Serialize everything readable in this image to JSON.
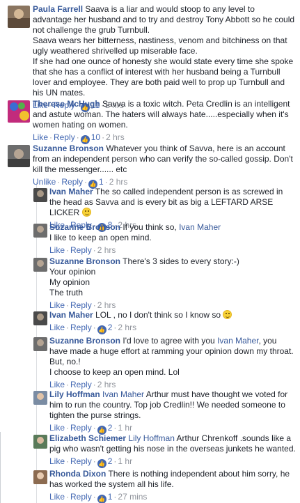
{
  "comments": [
    {
      "author": "Paula Farrell",
      "lines": [
        "Saava is a liar and would stoop to any level to advantage her husband and to try and destroy Tony Abbott so he could not challenge the grub Turnbull.",
        "Saava wears her bitterness, nastiness, venom and bitchiness on that ugly weathered shrivelled up miserable face.",
        "If she had one ounce of honesty she would state every time she spoke that she has a conflict of interest with her husband being a Turnbull lover and employee. They are both paid well to prop up Turnbull and his UN mates."
      ],
      "like": "Like",
      "reply": "Reply",
      "likes": "11",
      "time": "2 hrs"
    },
    {
      "author": "Therese McHugh",
      "lines": [
        "Savva is a toxic witch. Peta Credlin is an intelligent and astute woman. The haters will always hate.....especially when it's women hating on women."
      ],
      "like": "Like",
      "reply": "Reply",
      "likes": "10",
      "time": "2 hrs"
    },
    {
      "author": "Suzanne Bronson",
      "lines": [
        "Whatever you think of Savva, here is an account from an independent person who can verify the so-called gossip. Don't kill the messenger...... etc"
      ],
      "like": "Unlike",
      "reply": "Reply",
      "likes": "1",
      "time": "2 hrs"
    }
  ],
  "replies": [
    {
      "author": "Ivan Maher",
      "text": "The so called independent person is as screwed in the head as Savva and is every bit as big a LEFTARD ARSE LICKER",
      "like": "Like",
      "reply": "Reply",
      "likes": "8",
      "time": "2 hrs"
    },
    {
      "author": "Suzanne Bronson",
      "text_pre": "If you think so,",
      "mention": "Ivan Maher",
      "line2": "I like to keep an open mind.",
      "like": "Like",
      "reply": "Reply",
      "time": "2 hrs"
    },
    {
      "author": "Suzanne Bronson",
      "text": "There's 3 sides to every story:-)",
      "line2": "Your opinion",
      "line3": "My opinion",
      "line4": "The truth",
      "like": "Like",
      "reply": "Reply",
      "time": "2 hrs"
    },
    {
      "author": "Ivan Maher",
      "text": "LOL , no I don't think so I know so",
      "like": "Like",
      "reply": "Reply",
      "likes": "2",
      "time": "2 hrs"
    },
    {
      "author": "Suzanne Bronson",
      "text_pre": "I'd love to agree with you",
      "mention": "Ivan Maher",
      "text_post": ", you have made a huge effort at ramming your opinion down my throat.",
      "line2": "But, no.!",
      "line3": "I choose to keep an open mind. Lol",
      "like": "Like",
      "reply": "Reply",
      "time": "2 hrs"
    },
    {
      "author": "Lily Hoffman",
      "mention": "Ivan Maher",
      "text_post": "Arthur must have thought we voted for him to run the country. Top job Credlin!! We needed someone to tighten the purse strings.",
      "like": "Like",
      "reply": "Reply",
      "likes": "2",
      "time": "1 hr"
    },
    {
      "author": "Elizabeth Schiemer",
      "mention": "Lily Hoffman",
      "text_post": "Arthur Chrenkoff .sounds like a pig who wasn't getting his nose in the overseas junkets he wanted.",
      "like": "Like",
      "reply": "Reply",
      "likes": "2",
      "time": "1 hr"
    },
    {
      "author": "Rhonda Dixon",
      "text": "There is nothing independent about him sorry, he has worked the system all his life.",
      "like": "Like",
      "reply": "Reply",
      "likes": "1",
      "time": "27 mins"
    }
  ],
  "colors": {
    "link": "#365899",
    "action": "#4267b2",
    "meta": "#90949c",
    "text": "#1d2129"
  },
  "icons": {
    "like_badge": "thumbs-up-icon",
    "emoji": "smiley-emoji-icon"
  }
}
